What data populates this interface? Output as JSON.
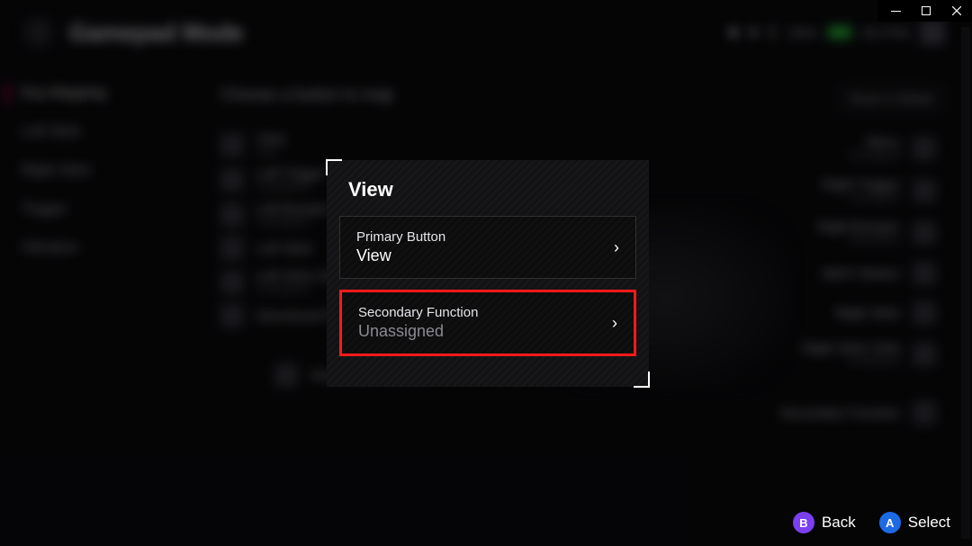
{
  "titlebar": {
    "min": "—",
    "max": "▢",
    "close": "✕"
  },
  "header": {
    "title": "Gamepad Mode"
  },
  "status": {
    "battery_pct": "100%",
    "time": "06:17PM"
  },
  "sidebar": {
    "items": [
      {
        "label": "Key Mapping",
        "active": true
      },
      {
        "label": "Left Stick"
      },
      {
        "label": "Right Stick"
      },
      {
        "label": "Trigger"
      },
      {
        "label": "Vibration"
      }
    ]
  },
  "content": {
    "title": "Choose a button to map",
    "reset": "Reset to Default",
    "left_maps": [
      {
        "name": "View",
        "value": "View"
      },
      {
        "name": "Left Trigger",
        "value": "Unassigned"
      },
      {
        "name": "Left Bumper",
        "value": "Unassigned"
      },
      {
        "name": "Left Stick",
        "value": ""
      },
      {
        "name": "Left Stick Click",
        "value": "Unassigned"
      },
      {
        "name": "Directional Pad",
        "value": ""
      },
      {
        "name": "Secondary Function",
        "value": ""
      }
    ],
    "right_maps": [
      {
        "name": "Menu",
        "value": "Unassigned"
      },
      {
        "name": "Right Trigger",
        "value": "Unassigned"
      },
      {
        "name": "Right Bumper",
        "value": "Unassigned"
      },
      {
        "name": "ABXY Button",
        "value": ""
      },
      {
        "name": "Right Stick",
        "value": ""
      },
      {
        "name": "Right Stick Click",
        "value": "Unassigned"
      },
      {
        "name": "Secondary Function",
        "value": ""
      }
    ]
  },
  "modal": {
    "title": "View",
    "primary": {
      "label": "Primary Button",
      "value": "View"
    },
    "secondary": {
      "label": "Secondary Function",
      "value": "Unassigned"
    }
  },
  "footer": {
    "back_glyph": "B",
    "back": "Back",
    "select_glyph": "A",
    "select": "Select"
  }
}
